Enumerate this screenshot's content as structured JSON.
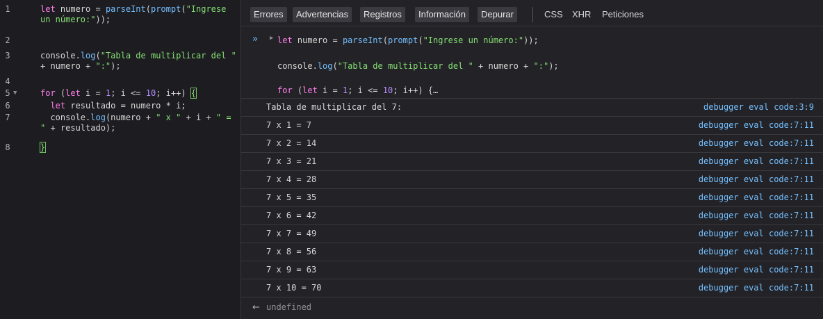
{
  "editor": {
    "lines": [
      {
        "num": "1",
        "parts": [
          {
            "t": "let ",
            "c": "kw"
          },
          {
            "t": "numero = ",
            "c": "plain"
          },
          {
            "t": "parseInt",
            "c": "fn"
          },
          {
            "t": "(",
            "c": "plain"
          },
          {
            "t": "prompt",
            "c": "fn"
          },
          {
            "t": "(",
            "c": "plain"
          },
          {
            "t": "\"Ingrese un número:\"",
            "c": "str"
          },
          {
            "t": "));",
            "c": "plain"
          }
        ]
      },
      {
        "num": "2",
        "parts": []
      },
      {
        "num": "3",
        "parts": [
          {
            "t": "console",
            "c": "plain"
          },
          {
            "t": ".",
            "c": "plain"
          },
          {
            "t": "log",
            "c": "fn"
          },
          {
            "t": "(",
            "c": "plain"
          },
          {
            "t": "\"Tabla de multiplicar del \"",
            "c": "str"
          },
          {
            "t": " + numero + ",
            "c": "plain"
          },
          {
            "t": "\":\"",
            "c": "str"
          },
          {
            "t": ");",
            "c": "plain"
          }
        ]
      },
      {
        "num": "4",
        "parts": []
      },
      {
        "num": "5",
        "parts": [
          {
            "t": "for ",
            "c": "kw"
          },
          {
            "t": "(",
            "c": "plain"
          },
          {
            "t": "let ",
            "c": "kw"
          },
          {
            "t": "i = ",
            "c": "plain"
          },
          {
            "t": "1",
            "c": "num"
          },
          {
            "t": "; i <= ",
            "c": "plain"
          },
          {
            "t": "10",
            "c": "num"
          },
          {
            "t": "; i++) ",
            "c": "plain"
          },
          {
            "t": "{",
            "c": "bracket-hl"
          }
        ]
      },
      {
        "num": "6",
        "parts": [
          {
            "t": "  ",
            "c": "plain"
          },
          {
            "t": "let ",
            "c": "kw"
          },
          {
            "t": "resultado = numero * i;",
            "c": "plain"
          }
        ]
      },
      {
        "num": "7",
        "parts": [
          {
            "t": "  console.",
            "c": "plain"
          },
          {
            "t": "log",
            "c": "fn"
          },
          {
            "t": "(numero + ",
            "c": "plain"
          },
          {
            "t": "\" x \"",
            "c": "str"
          },
          {
            "t": " + i + ",
            "c": "plain"
          },
          {
            "t": "\" = \"",
            "c": "str"
          },
          {
            "t": " + resultado);",
            "c": "plain"
          }
        ]
      },
      {
        "num": "8",
        "parts": [
          {
            "t": "}",
            "c": "bracket-hl"
          }
        ]
      }
    ],
    "fold_icon": "chevron-down-icon",
    "fold_glyph": "▼"
  },
  "toolbar": {
    "filters": [
      "Errores",
      "Advertencias",
      "Registros",
      "Información",
      "Depurar"
    ],
    "links": [
      "CSS",
      "XHR",
      "Peticiones"
    ]
  },
  "input": {
    "prompt_icon": "double-chevron-icon",
    "prompt_glyph": "»",
    "expand_icon": "expand-arrow-icon",
    "expand_glyph": "▶",
    "lines": [
      [
        {
          "t": "let ",
          "c": "kw"
        },
        {
          "t": "numero = ",
          "c": "plain"
        },
        {
          "t": "parseInt",
          "c": "fn"
        },
        {
          "t": "(",
          "c": "plain"
        },
        {
          "t": "prompt",
          "c": "fn"
        },
        {
          "t": "(",
          "c": "plain"
        },
        {
          "t": "\"Ingrese un número:\"",
          "c": "str"
        },
        {
          "t": "));",
          "c": "plain"
        }
      ],
      [
        {
          "t": "console",
          "c": "plain"
        },
        {
          "t": ".",
          "c": "plain"
        },
        {
          "t": "log",
          "c": "fn"
        },
        {
          "t": "(",
          "c": "plain"
        },
        {
          "t": "\"Tabla de multiplicar del \"",
          "c": "str"
        },
        {
          "t": " + numero + ",
          "c": "plain"
        },
        {
          "t": "\":\"",
          "c": "str"
        },
        {
          "t": ");",
          "c": "plain"
        }
      ],
      [
        {
          "t": "for ",
          "c": "kw"
        },
        {
          "t": "(",
          "c": "plain"
        },
        {
          "t": "let ",
          "c": "kw"
        },
        {
          "t": "i = ",
          "c": "plain"
        },
        {
          "t": "1",
          "c": "num"
        },
        {
          "t": "; i <= ",
          "c": "plain"
        },
        {
          "t": "10",
          "c": "num"
        },
        {
          "t": "; i++) {…",
          "c": "plain"
        }
      ]
    ]
  },
  "logs": [
    {
      "message": "Tabla de multiplicar del 7:",
      "source": "debugger eval code:3:9"
    },
    {
      "message": "7 x 1 = 7",
      "source": "debugger eval code:7:11"
    },
    {
      "message": "7 x 2 = 14",
      "source": "debugger eval code:7:11"
    },
    {
      "message": "7 x 3 = 21",
      "source": "debugger eval code:7:11"
    },
    {
      "message": "7 x 4 = 28",
      "source": "debugger eval code:7:11"
    },
    {
      "message": "7 x 5 = 35",
      "source": "debugger eval code:7:11"
    },
    {
      "message": "7 x 6 = 42",
      "source": "debugger eval code:7:11"
    },
    {
      "message": "7 x 7 = 49",
      "source": "debugger eval code:7:11"
    },
    {
      "message": "7 x 8 = 56",
      "source": "debugger eval code:7:11"
    },
    {
      "message": "7 x 9 = 63",
      "source": "debugger eval code:7:11"
    },
    {
      "message": "7 x 10 = 70",
      "source": "debugger eval code:7:11"
    }
  ],
  "result": {
    "icon": "return-arrow-icon",
    "glyph": "←",
    "text": "undefined"
  }
}
